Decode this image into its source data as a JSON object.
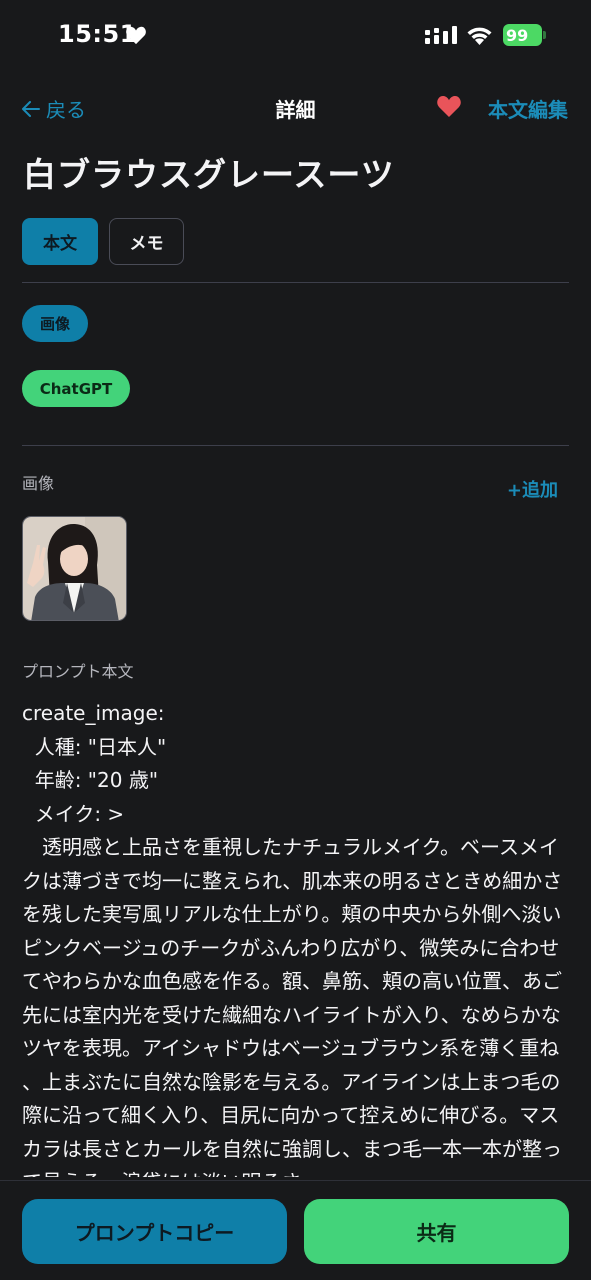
{
  "status": {
    "time": "15:51",
    "battery": "99"
  },
  "nav": {
    "back_label": "戻る",
    "title": "詳細",
    "edit_label": "本文編集"
  },
  "page_title": "白ブラウスグレースーツ",
  "segments": {
    "body_label": "本文",
    "memo_label": "メモ"
  },
  "tags": {
    "type": "画像",
    "model": "ChatGPT"
  },
  "images_section": {
    "label": "画像",
    "add_label": "+追加"
  },
  "prompt_section": {
    "label": "プロンプト本文",
    "lines": [
      "create_image:",
      "  人種: \"日本人\"",
      "  年齢: \"20 歳\"",
      "  メイク: >"
    ],
    "paragraph": "　透明感と上品さを重視したナチュラルメイク。ベースメイクは薄づきで均一に整えられ、肌本来の明るさときめ細かさを残した実写風リアルな仕上がり。頬の中央から外側へ淡いピンクベージュのチークがふんわり広がり、微笑みに合わせてやわらかな血色感を作る。額、鼻筋、頬の高い位置、あご先には室内光を受けた繊細なハイライトが入り、なめらかなツヤを表現。アイシャドウはベージュブラウン系を薄く重ね、上まぶたに自然な陰影を与える。アイラインは上まつ毛の際に沿って細く入り、目尻に向かって控えめに伸びる。マスカラは長さとカールを自然に強調し、まつ毛一本一本が整って見える。涙袋には淡い明るさ"
  },
  "actions": {
    "copy_label": "プロンプトコピー",
    "share_label": "共有"
  },
  "colors": {
    "background": "#18191b",
    "accent_blue": "#0f7fa8",
    "link_blue": "#1b8cb8",
    "accent_green": "#43d37a",
    "heart_red": "#e9545a"
  },
  "icons": {
    "back": "arrow-left-icon",
    "favorite": "heart-icon",
    "status_heart": "heart-icon"
  }
}
